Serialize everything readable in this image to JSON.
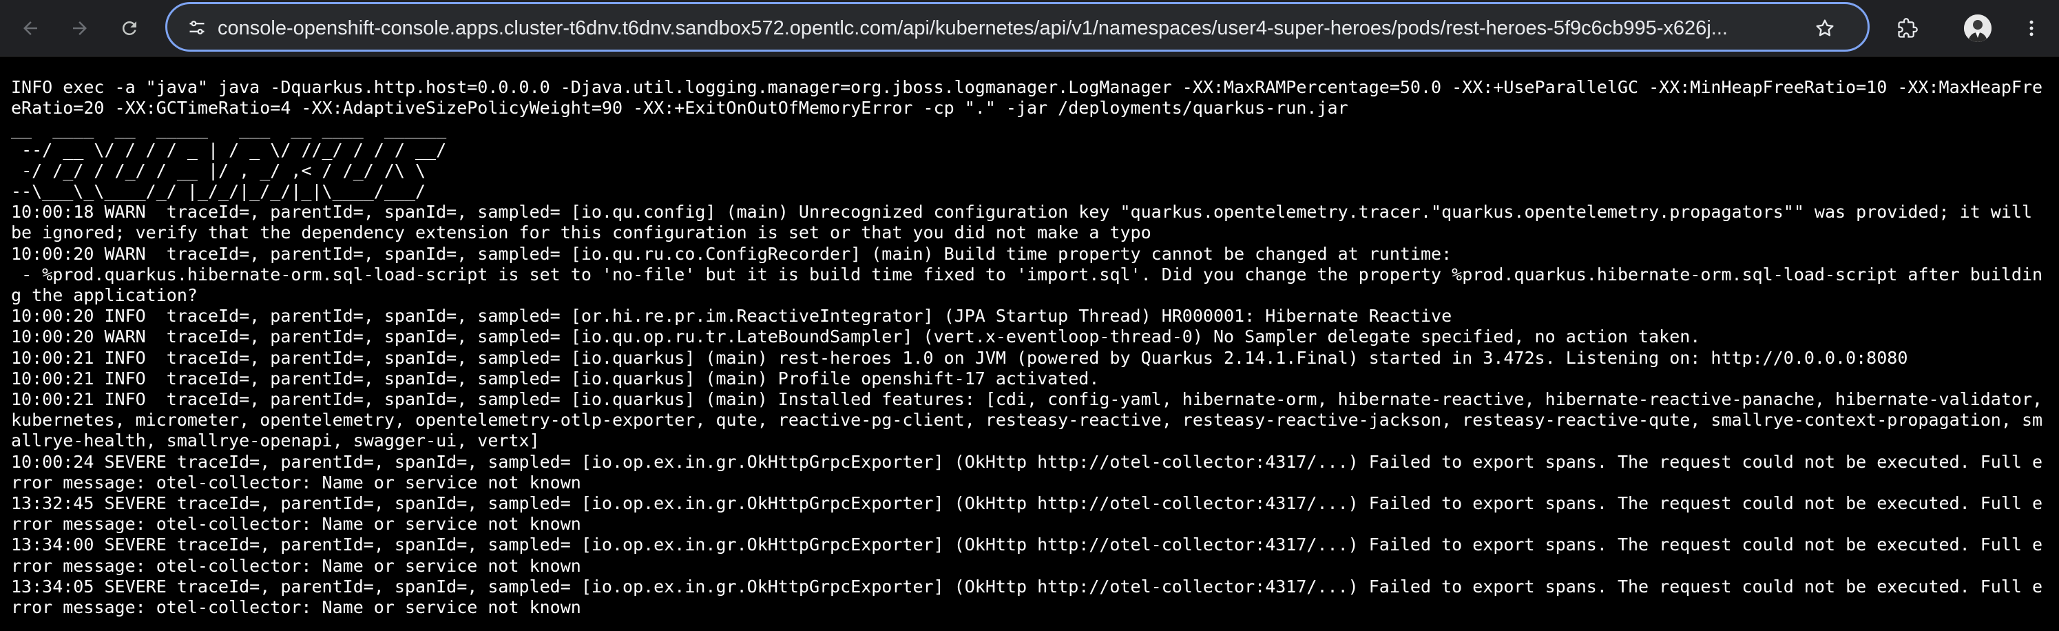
{
  "browser": {
    "url": "console-openshift-console.apps.cluster-t6dnv.t6dnv.sandbox572.opentlc.com/api/kubernetes/api/v1/namespaces/user4-super-heroes/pods/rest-heroes-5f9c6cb995-x626j...",
    "icons": {
      "back": "arrow-left-icon",
      "forward": "arrow-right-icon",
      "reload": "reload-icon",
      "site_info": "tune-icon",
      "bookmark": "star-icon",
      "extensions": "puzzle-icon",
      "profile": "avatar",
      "menu": "kebab-menu-icon"
    },
    "accent_color": "#7ea4f2"
  },
  "log": {
    "lines": [
      "INFO exec -a \"java\" java -Dquarkus.http.host=0.0.0.0 -Djava.util.logging.manager=org.jboss.logmanager.LogManager -XX:MaxRAMPercentage=50.0 -XX:+UseParallelGC -XX:MinHeapFreeRatio=10 -XX:MaxHeapFreeRatio=20 -XX:GCTimeRatio=4 -XX:AdaptiveSizePolicyWeight=90 -XX:+ExitOnOutOfMemoryError -cp \".\" -jar /deployments/quarkus-run.jar",
      "__  ____  __  _____   ___  __ ____  ______ ",
      " --/ __ \\/ / / / _ | / _ \\/ //_/ / / / __/ ",
      " -/ /_/ / /_/ / __ |/ , _/ ,< / /_/ /\\ \\   ",
      "--\\___\\_\\____/_/ |_/_/|_/_/|_|\\____/___/   ",
      "10:00:18 WARN  traceId=, parentId=, spanId=, sampled= [io.qu.config] (main) Unrecognized configuration key \"quarkus.opentelemetry.tracer.\"quarkus.opentelemetry.propagators\"\" was provided; it will be ignored; verify that the dependency extension for this configuration is set or that you did not make a typo",
      "10:00:20 WARN  traceId=, parentId=, spanId=, sampled= [io.qu.ru.co.ConfigRecorder] (main) Build time property cannot be changed at runtime:",
      " - %prod.quarkus.hibernate-orm.sql-load-script is set to 'no-file' but it is build time fixed to 'import.sql'. Did you change the property %prod.quarkus.hibernate-orm.sql-load-script after building the application?",
      "10:00:20 INFO  traceId=, parentId=, spanId=, sampled= [or.hi.re.pr.im.ReactiveIntegrator] (JPA Startup Thread) HR000001: Hibernate Reactive",
      "10:00:20 WARN  traceId=, parentId=, spanId=, sampled= [io.qu.op.ru.tr.LateBoundSampler] (vert.x-eventloop-thread-0) No Sampler delegate specified, no action taken.",
      "10:00:21 INFO  traceId=, parentId=, spanId=, sampled= [io.quarkus] (main) rest-heroes 1.0 on JVM (powered by Quarkus 2.14.1.Final) started in 3.472s. Listening on: http://0.0.0.0:8080",
      "10:00:21 INFO  traceId=, parentId=, spanId=, sampled= [io.quarkus] (main) Profile openshift-17 activated.",
      "10:00:21 INFO  traceId=, parentId=, spanId=, sampled= [io.quarkus] (main) Installed features: [cdi, config-yaml, hibernate-orm, hibernate-reactive, hibernate-reactive-panache, hibernate-validator, kubernetes, micrometer, opentelemetry, opentelemetry-otlp-exporter, qute, reactive-pg-client, resteasy-reactive, resteasy-reactive-jackson, resteasy-reactive-qute, smallrye-context-propagation, smallrye-health, smallrye-openapi, swagger-ui, vertx]",
      "10:00:24 SEVERE traceId=, parentId=, spanId=, sampled= [io.op.ex.in.gr.OkHttpGrpcExporter] (OkHttp http://otel-collector:4317/...) Failed to export spans. The request could not be executed. Full error message: otel-collector: Name or service not known",
      "13:32:45 SEVERE traceId=, parentId=, spanId=, sampled= [io.op.ex.in.gr.OkHttpGrpcExporter] (OkHttp http://otel-collector:4317/...) Failed to export spans. The request could not be executed. Full error message: otel-collector: Name or service not known",
      "13:34:00 SEVERE traceId=, parentId=, spanId=, sampled= [io.op.ex.in.gr.OkHttpGrpcExporter] (OkHttp http://otel-collector:4317/...) Failed to export spans. The request could not be executed. Full error message: otel-collector: Name or service not known",
      "13:34:05 SEVERE traceId=, parentId=, spanId=, sampled= [io.op.ex.in.gr.OkHttpGrpcExporter] (OkHttp http://otel-collector:4317/...) Failed to export spans. The request could not be executed. Full error message: otel-collector: Name or service not known"
    ]
  }
}
